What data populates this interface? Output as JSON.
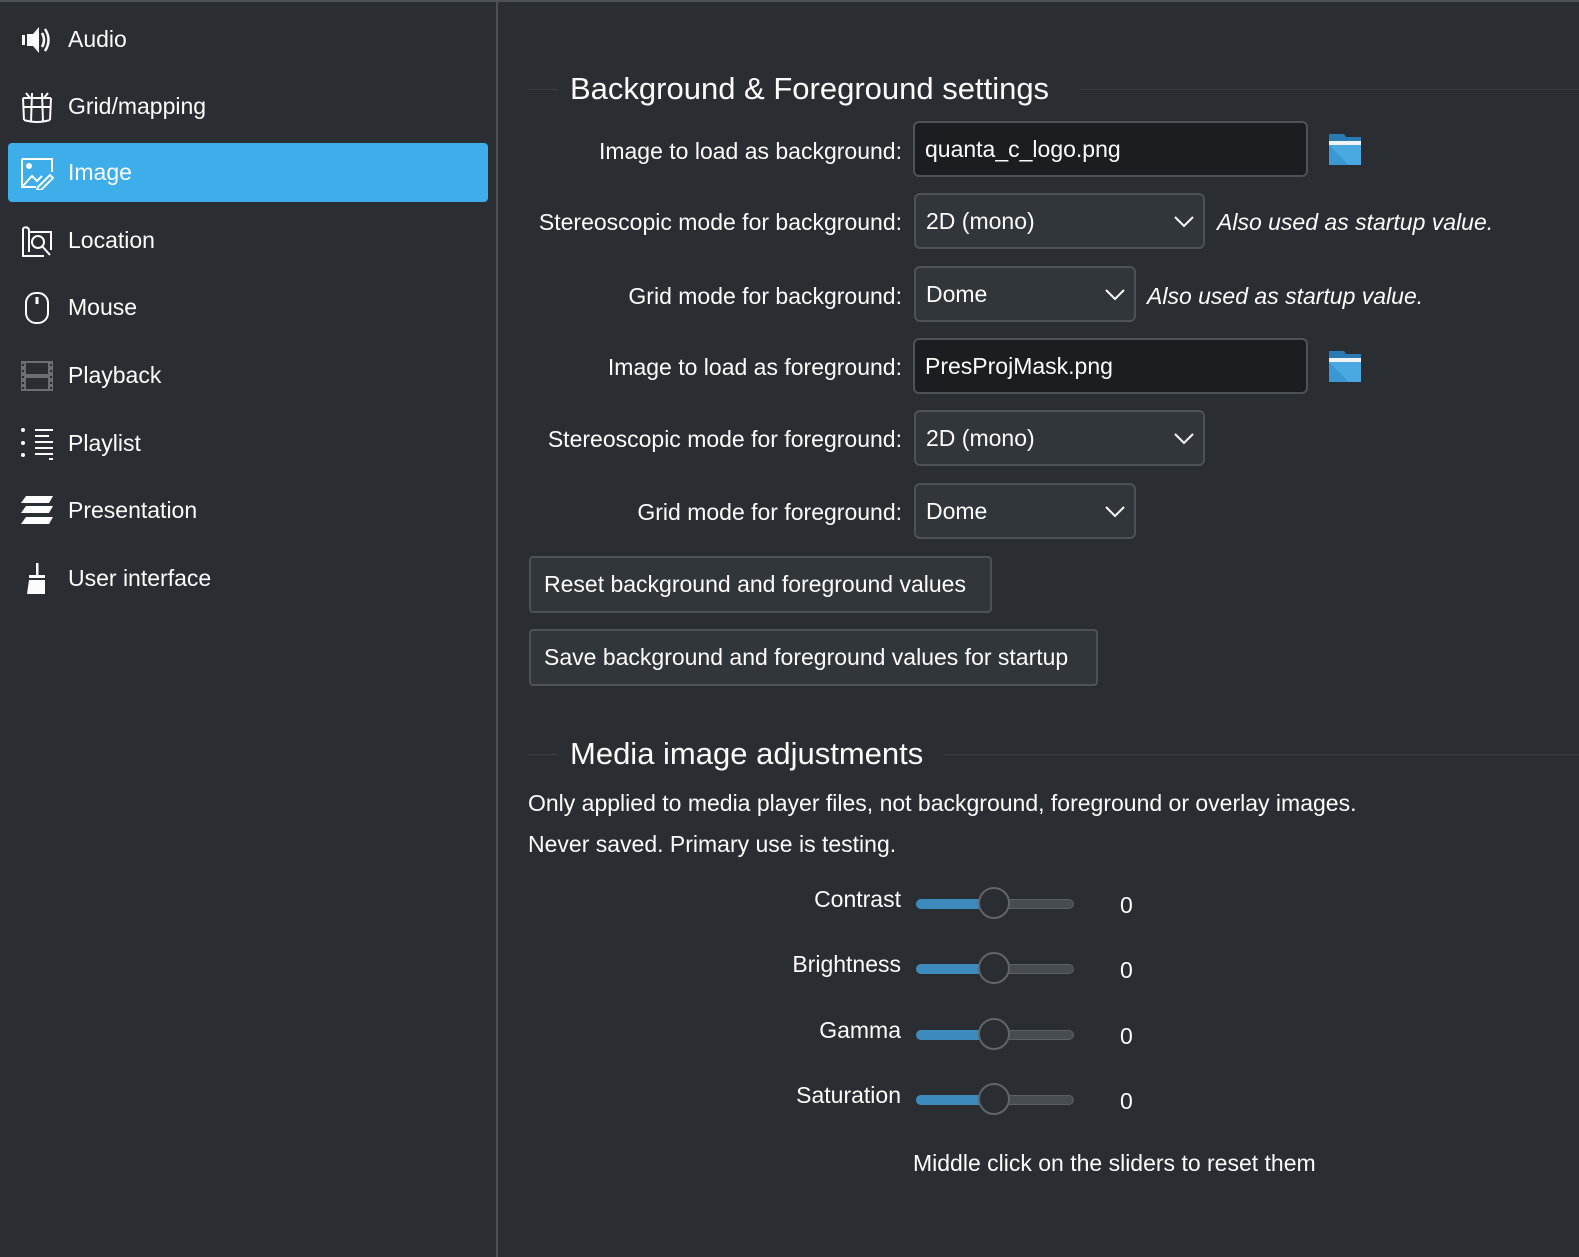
{
  "sidebar": {
    "active_index": 2,
    "items": [
      {
        "label": "Audio",
        "icon": "speaker-icon"
      },
      {
        "label": "Grid/mapping",
        "icon": "dome-grid-icon"
      },
      {
        "label": "Image",
        "icon": "image-edit-icon"
      },
      {
        "label": "Location",
        "icon": "map-search-icon"
      },
      {
        "label": "Mouse",
        "icon": "mouse-icon"
      },
      {
        "label": "Playback",
        "icon": "film-strip-icon"
      },
      {
        "label": "Playlist",
        "icon": "playlist-icon"
      },
      {
        "label": "Presentation",
        "icon": "layers-icon"
      },
      {
        "label": "User interface",
        "icon": "paint-brush-icon"
      }
    ]
  },
  "bg_fg": {
    "title": "Background & Foreground settings",
    "bg_image_label": "Image to load as background:",
    "bg_image_value": "quanta_c_logo.png",
    "bg_stereo_label": "Stereoscopic mode for background:",
    "bg_stereo_value": "2D (mono)",
    "bg_stereo_hint": "Also used as startup value.",
    "bg_grid_label": "Grid mode for background:",
    "bg_grid_value": "Dome",
    "bg_grid_hint": "Also used as startup value.",
    "fg_image_label": "Image to load as foreground:",
    "fg_image_value": "PresProjMask.png",
    "fg_stereo_label": "Stereoscopic mode for foreground:",
    "fg_stereo_value": "2D (mono)",
    "fg_grid_label": "Grid mode for foreground:",
    "fg_grid_value": "Dome",
    "reset_button": "Reset background and foreground values",
    "save_button": "Save background and foreground values for startup"
  },
  "media": {
    "title": "Media image adjustments",
    "desc1": "Only applied to media player files, not background, foreground or overlay images.",
    "desc2": "Never saved. Primary use is testing.",
    "sliders": [
      {
        "label": "Contrast",
        "value": "0",
        "fraction": 0.5
      },
      {
        "label": "Brightness",
        "value": "0",
        "fraction": 0.5
      },
      {
        "label": "Gamma",
        "value": "0",
        "fraction": 0.5
      },
      {
        "label": "Saturation",
        "value": "0",
        "fraction": 0.5
      }
    ],
    "footnote": "Middle click on the sliders to reset them"
  },
  "colors": {
    "accent": "#3daee9",
    "slider_fill": "#3d8bbd",
    "background": "#2a2e33"
  }
}
